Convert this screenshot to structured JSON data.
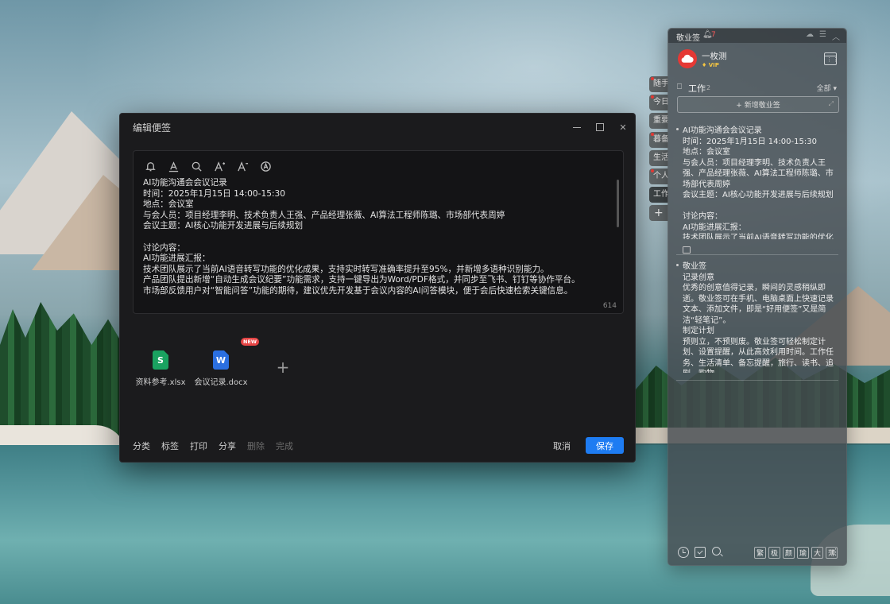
{
  "editor": {
    "title": "编辑便签",
    "char_count": "614",
    "lines": [
      "AI功能沟通会会议记录",
      "时间：2025年1月15日 14:00-15:30",
      "地点：会议室",
      "与会人员：项目经理李明、技术负责人王强、产品经理张薇、AI算法工程师陈璐、市场部代表周婷",
      "会议主题：AI核心功能开发进展与后续规划",
      "",
      "讨论内容：",
      "AI功能进展汇报：",
      "技术团队展示了当前AI语音转写功能的优化成果，支持实时转写准确率提升至95%，并新增多语种识别能力。",
      "产品团队提出新增“自动生成会议纪要”功能需求，支持一键导出为Word/PDF格式，并同步至飞书、钉钉等协作平台。",
      "市场部反馈用户对“智能问答”功能的期待，建议优先开发基于会议内容的AI问答模块，便于会后快速检索关键信息。"
    ],
    "attachments": [
      {
        "name": "资料参考.xlsx",
        "icon_letter": "S",
        "icon": "xlsx-file-icon"
      },
      {
        "name": "会议记录.docx",
        "icon_letter": "W",
        "icon": "docx-file-icon"
      }
    ],
    "new_badge": "NEW",
    "add_attachment": "+",
    "footer": {
      "category": "分类",
      "tag": "标签",
      "print": "打印",
      "share": "分享",
      "delete": "删除",
      "done": "完成",
      "cancel": "取消",
      "save": "保存"
    }
  },
  "side_tabs": [
    {
      "label": "随手",
      "dot": true
    },
    {
      "label": "今日",
      "dot": true
    },
    {
      "label": "重要",
      "dot": false
    },
    {
      "label": "暮备",
      "dot": true
    },
    {
      "label": "生活",
      "dot": false
    },
    {
      "label": "个人",
      "dot": true
    },
    {
      "label": "工作",
      "dot": false,
      "active": true
    },
    {
      "label": "+",
      "dot": false
    }
  ],
  "panel": {
    "app_name": "敬业签",
    "reminder_count": "7",
    "user": {
      "name": "一枚测",
      "badge": "VIP"
    },
    "category": {
      "name": "工作",
      "count": "2"
    },
    "filter": "全部",
    "new_note_label": "+ 新增敬业签",
    "notes": [
      {
        "lines": [
          "AI功能沟通会会议记录",
          "时间：2025年1月15日 14:00-15:30",
          "地点：会议室",
          "与会人员：项目经理李明、技术负责人王强、产品经理张薇、AI算法工程师陈璐、市场部代表周婷",
          "会议主题：AI核心功能开发进展与后续规划",
          "",
          "讨论内容：",
          "AI功能进展汇报：",
          "技术团队展示了当前AI语音转写功能的优化成果"
        ]
      },
      {
        "lines": [
          "敬业签",
          "记录创意",
          "优秀的创意值得记录，瞬间的灵感稍纵即逝。敬业签可在手机、电脑桌面上快速记录文本、添加文件，即是“好用便签”又是简洁“轻笔记”。",
          "制定计划",
          "预则立，不预则废。敬业签可轻松制定计划、设置提醒，从此高效利用时间。工作任务、生活清单、备忘提醒，旅行、读书、追剧、购物"
        ]
      }
    ],
    "font_buttons": [
      "繁",
      "极",
      "颜",
      "瑜",
      "大",
      "薄"
    ]
  },
  "colors": {
    "accent": "#1e7cf2",
    "brand_red": "#e53935",
    "vip_gold": "#f4c542",
    "new_badge": "#e64545"
  }
}
